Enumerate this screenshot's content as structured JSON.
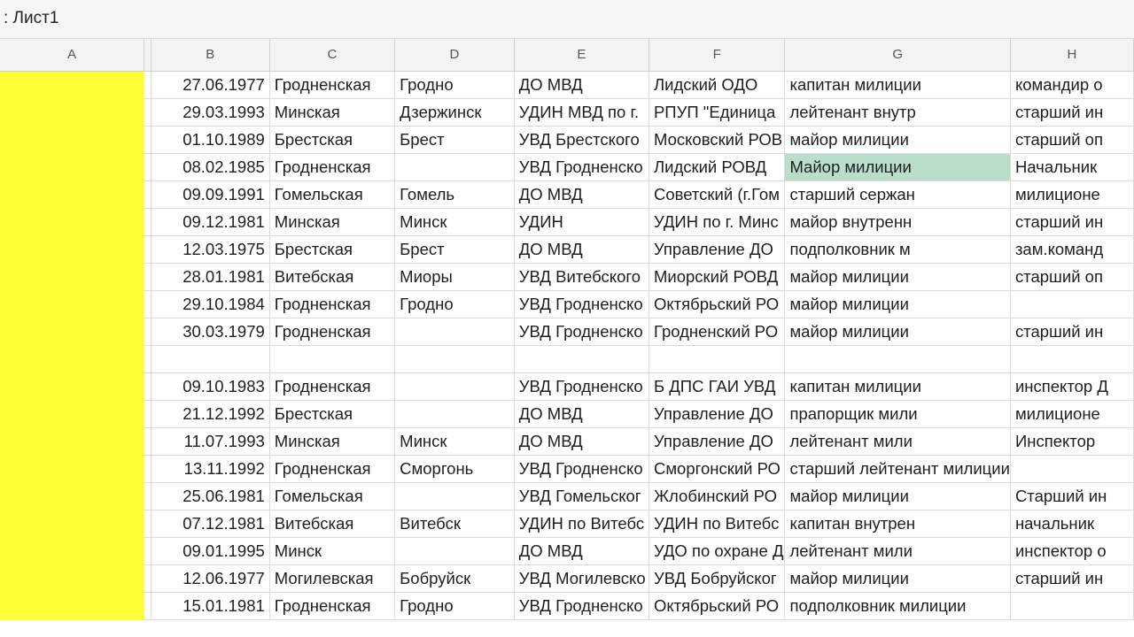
{
  "sheet": {
    "title": ": Лист1"
  },
  "columns": [
    "A",
    "B",
    "C",
    "D",
    "E",
    "F",
    "G",
    "H"
  ],
  "rows": [
    [
      "",
      "27.06.1977",
      "Гродненская",
      "Гродно",
      "ДО МВД",
      "Лидский ОДО",
      "капитан милиции",
      "командир о"
    ],
    [
      "",
      "29.03.1993",
      "Минская",
      "Дзержинск",
      "УДИН МВД по г.",
      "РПУП \"Единица",
      "лейтенант внутр",
      "старший ин"
    ],
    [
      "",
      "01.10.1989",
      "Брестская",
      "Брест",
      "УВД Брестского",
      "Московский РОВ",
      "майор милиции",
      "старший оп"
    ],
    [
      "",
      "08.02.1985",
      "Гродненская",
      "",
      "УВД Гродненско",
      "Лидский РОВД",
      "Майор милиции",
      "Начальник"
    ],
    [
      "",
      "09.09.1991",
      "Гомельская",
      "Гомель",
      "ДО МВД",
      "Советский (г.Гом",
      "старший сержан",
      "милиционе"
    ],
    [
      "",
      "09.12.1981",
      "Минская",
      "Минск",
      "УДИН",
      "УДИН по г. Минс",
      "майор внутренн",
      "старший ин"
    ],
    [
      "",
      "12.03.1975",
      "Брестская",
      "Брест",
      "ДО МВД",
      "Управление ДО",
      "подполковник м",
      "зам.команд"
    ],
    [
      "",
      "28.01.1981",
      "Витебская",
      "Миоры",
      "УВД Витебского",
      "Миорский РОВД",
      "майор милиции",
      "старший оп"
    ],
    [
      "",
      "29.10.1984",
      "Гродненская",
      "Гродно",
      "УВД Гродненско",
      "Октябрьский РО",
      "майор милиции",
      ""
    ],
    [
      "",
      "30.03.1979",
      "Гродненская",
      "",
      "УВД Гродненско",
      "Гродненский РО",
      "майор милиции",
      "старший ин"
    ],
    [
      "",
      "",
      "",
      "",
      "",
      "",
      "",
      ""
    ],
    [
      "",
      "09.10.1983",
      "Гродненская",
      "",
      "УВД Гродненско",
      "Б ДПС ГАИ УВД",
      "капитан милиции",
      "инспектор Д"
    ],
    [
      "",
      "21.12.1992",
      "Брестская",
      "",
      "ДО МВД",
      "Управление ДО",
      "прапорщик мили",
      "милиционе"
    ],
    [
      "",
      "11.07.1993",
      "Минская",
      "Минск",
      "ДО МВД",
      "Управление ДО",
      "лейтенант мили",
      "Инспектор"
    ],
    [
      "",
      "13.11.1992",
      "Гродненская",
      "Сморгонь",
      "УВД Гродненско",
      "Сморгонский РО",
      "старший лейтенант милиции",
      ""
    ],
    [
      "",
      "25.06.1981",
      "Гомельская",
      "",
      "УВД Гомельског",
      "Жлобинский РО",
      "майор милиции",
      "Старший ин"
    ],
    [
      "",
      "07.12.1981",
      "Витебская",
      "Витебск",
      "УДИН по Витебс",
      "УДИН по Витебс",
      "капитан внутрен",
      "начальник"
    ],
    [
      "",
      "09.01.1995",
      "Минск",
      "",
      "ДО МВД",
      "УДО по охране Д",
      "лейтенант мили",
      "инспектор о"
    ],
    [
      "",
      "12.06.1977",
      "Могилевская",
      "Бобруйск",
      "УВД Могилевско",
      "УВД Бобруйског",
      "майор милиции",
      "старший ин"
    ],
    [
      "",
      "15.01.1981",
      "Гродненская",
      "Гродно",
      "УВД Гродненско",
      "Октябрьский РО",
      "подполковник милиции",
      ""
    ]
  ],
  "colors": {
    "column_a_fill": "#ffff37",
    "highlight_cell": "#b9dfca"
  },
  "highlighted_cell": {
    "row": 3,
    "col": 6
  }
}
